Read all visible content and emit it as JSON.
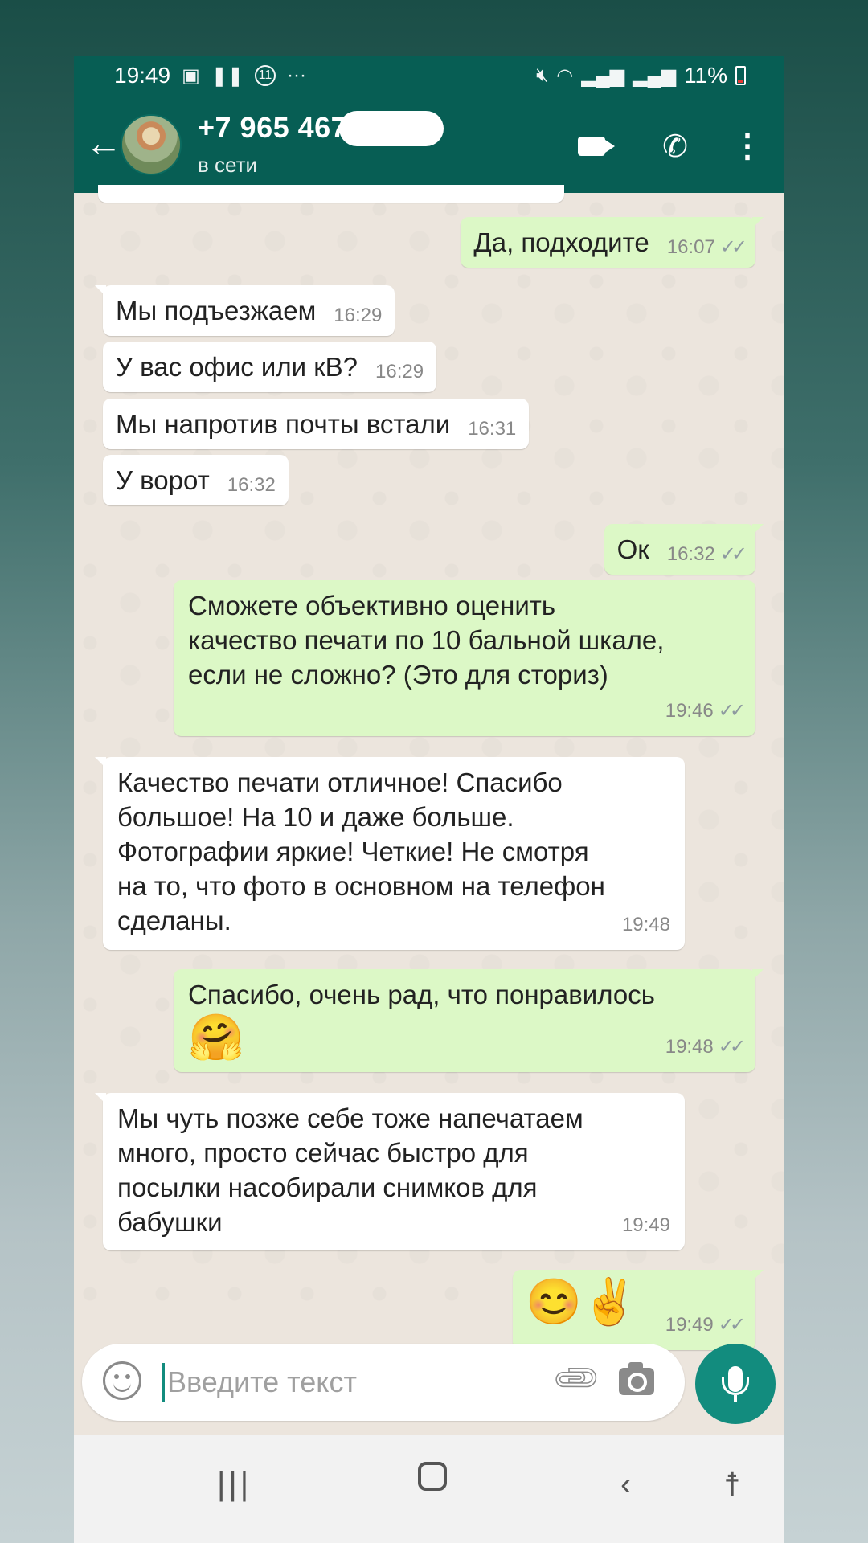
{
  "status_bar": {
    "time": "19:49",
    "left_icons": [
      "image-icon",
      "pause-icon",
      "notification-11-icon",
      "more-dots-icon"
    ],
    "notification_count": "11",
    "battery": "11%",
    "right_icons": [
      "mute-icon",
      "wifi-icon",
      "signal-icon",
      "signal-icon",
      "battery-icon"
    ]
  },
  "header": {
    "contact_name": "+7 965 467",
    "contact_status": "в сети",
    "icons": [
      "back-arrow-icon",
      "video-call-icon",
      "voice-call-icon",
      "more-vert-icon"
    ]
  },
  "messages": [
    {
      "direction": "out",
      "text": "Да, подходите",
      "time": "16:07",
      "read": true
    },
    {
      "direction": "in",
      "text": "Мы подъезжаем",
      "time": "16:29"
    },
    {
      "direction": "in",
      "text": "У вас офис или кВ?",
      "time": "16:29"
    },
    {
      "direction": "in",
      "text": "Мы напротив почты встали",
      "time": "16:31"
    },
    {
      "direction": "in",
      "text": "У ворот",
      "time": "16:32"
    },
    {
      "direction": "out",
      "text": "Ок",
      "time": "16:32",
      "read": true
    },
    {
      "direction": "out",
      "lines": [
        "Сможете объективно оценить",
        "качество печати по 10 бальной шкале,",
        "если не сложно? (Это для сториз)"
      ],
      "time": "19:46",
      "read": true
    },
    {
      "direction": "in",
      "lines": [
        "Качество печати отличное! Спасибо",
        "большое! На 10 и даже больше.",
        "Фотографии яркие! Четкие! Не смотря",
        "на то, что фото в основном на телефон",
        "сделаны."
      ],
      "time": "19:48"
    },
    {
      "direction": "out",
      "text": "Спасибо, очень рад, что понравилось",
      "emoji": "🤗",
      "time": "19:48",
      "read": true
    },
    {
      "direction": "in",
      "lines": [
        "Мы чуть позже себе тоже напечатаем",
        "много, просто сейчас быстро для",
        "посылки насобирали снимков для",
        "бабушки"
      ],
      "time": "19:49"
    },
    {
      "direction": "out",
      "emoji": "😊✌",
      "time": "19:49",
      "read": true
    }
  ],
  "composer": {
    "placeholder": "Введите текст",
    "icons": [
      "emoji-icon",
      "attach-icon",
      "camera-icon",
      "mic-icon"
    ]
  },
  "ticks_glyph": "✓✓",
  "colors": {
    "header": "#075e54",
    "outgoing_bubble": "#dcf8c6",
    "incoming_bubble": "#ffffff",
    "chat_background": "#ece5dd",
    "accent": "#128c7e"
  }
}
